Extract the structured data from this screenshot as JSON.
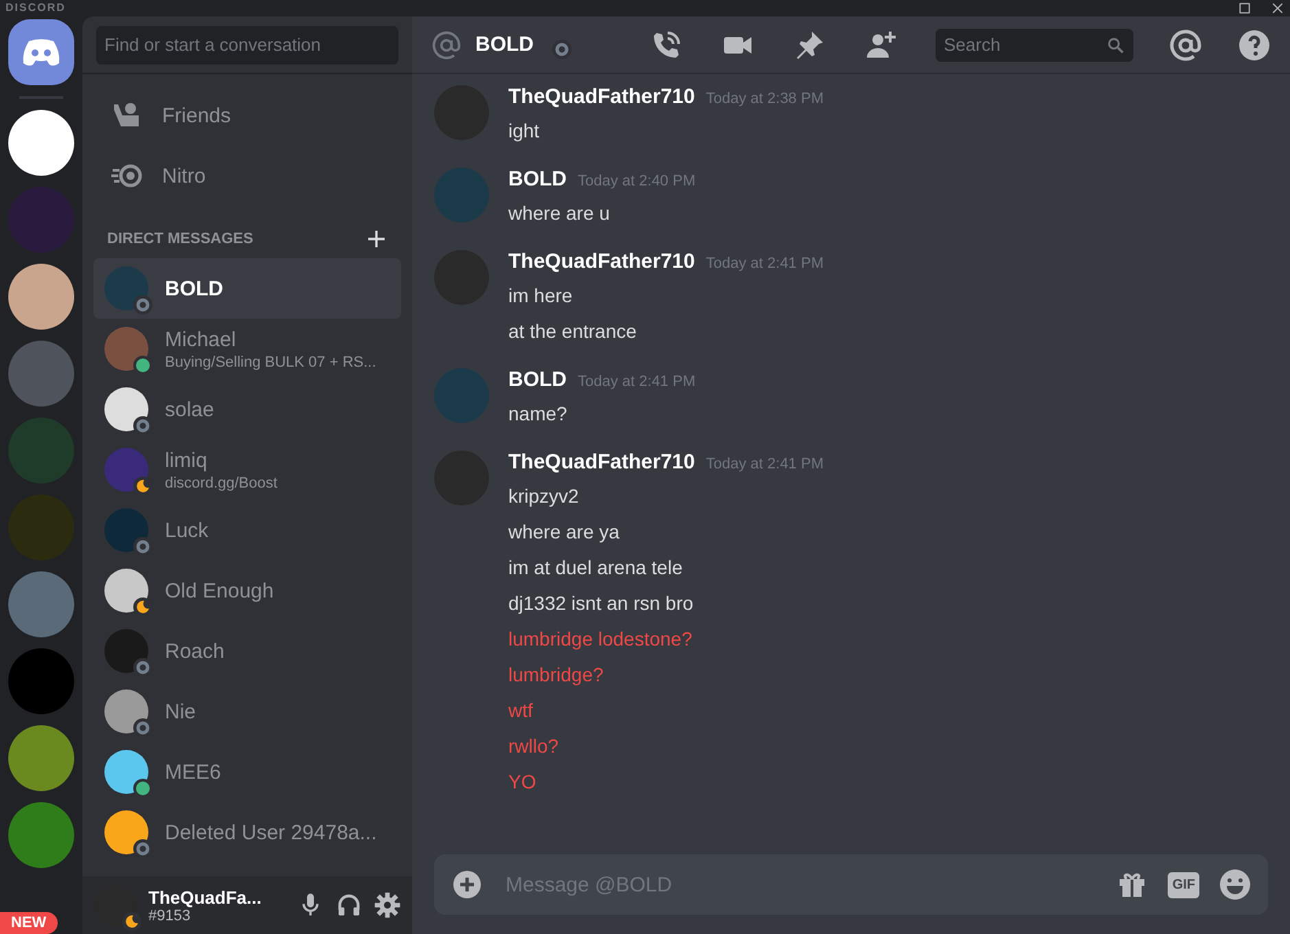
{
  "app": {
    "title": "DISCORD"
  },
  "servers": [
    {
      "kind": "home",
      "color": "#7289da"
    },
    {
      "kind": "server",
      "color": "#ffffff"
    },
    {
      "kind": "server",
      "color": "#2a1a3e"
    },
    {
      "kind": "server",
      "color": "#c9a58e"
    },
    {
      "kind": "server",
      "color": "#4f545c"
    },
    {
      "kind": "server",
      "color": "#1f3b2a"
    },
    {
      "kind": "server",
      "color": "#2b2b10"
    },
    {
      "kind": "server",
      "color": "#5a6a78"
    },
    {
      "kind": "server",
      "color": "#000000"
    },
    {
      "kind": "server",
      "color": "#6a8a20"
    },
    {
      "kind": "server",
      "color": "#2e7d1a"
    }
  ],
  "new_badge": "NEW",
  "search": {
    "placeholder": "Find or start a conversation"
  },
  "nav": [
    {
      "kind": "friends",
      "label": "Friends"
    },
    {
      "kind": "nitro",
      "label": "Nitro"
    }
  ],
  "dm_heading": "DIRECT MESSAGES",
  "dms": [
    {
      "name": "BOLD",
      "kind": "offline",
      "selected": true,
      "color": "#1b3a4a"
    },
    {
      "name": "Michael",
      "subtitle": "Buying/Selling BULK 07 + RS...",
      "kind": "online",
      "selected": false,
      "color": "#7a5040"
    },
    {
      "name": "solae",
      "kind": "offline",
      "selected": false,
      "color": "#dddddd"
    },
    {
      "name": "limiq",
      "subtitle": "discord.gg/Boost",
      "kind": "idle",
      "selected": false,
      "color": "#3a2a7a"
    },
    {
      "name": "Luck",
      "kind": "offline",
      "selected": false,
      "color": "#0e2a3a"
    },
    {
      "name": "Old Enough",
      "kind": "idle",
      "selected": false,
      "color": "#c8c8c8"
    },
    {
      "name": "Roach",
      "kind": "offline",
      "selected": false,
      "color": "#1a1a1a"
    },
    {
      "name": "Nie",
      "kind": "offline",
      "selected": false,
      "color": "#9a9a9a"
    },
    {
      "name": "MEE6",
      "kind": "online",
      "selected": false,
      "color": "#5bc7ef"
    },
    {
      "name": "Deleted User 29478a...",
      "kind": "offline",
      "selected": false,
      "color": "#faa61a"
    }
  ],
  "user": {
    "name": "TheQuadFa...",
    "tag": "#9153",
    "kind": "idle"
  },
  "channel": {
    "name": "BOLD",
    "kind": "offline"
  },
  "header_search": {
    "placeholder": "Search"
  },
  "messages": [
    {
      "author": "TheQuadFather710",
      "time": "Today at 2:38 PM",
      "color": "#2a2a2a",
      "lines": [
        {
          "text": "ight",
          "color": "#dcddde"
        }
      ]
    },
    {
      "author": "BOLD",
      "time": "Today at 2:40 PM",
      "color": "#1b3a4a",
      "lines": [
        {
          "text": "where are u",
          "color": "#dcddde"
        }
      ]
    },
    {
      "author": "TheQuadFather710",
      "time": "Today at 2:41 PM",
      "color": "#2a2a2a",
      "lines": [
        {
          "text": "im here",
          "color": "#dcddde"
        },
        {
          "text": "at the entrance",
          "color": "#dcddde"
        }
      ]
    },
    {
      "author": "BOLD",
      "time": "Today at 2:41 PM",
      "color": "#1b3a4a",
      "lines": [
        {
          "text": "name?",
          "color": "#dcddde"
        }
      ]
    },
    {
      "author": "TheQuadFather710",
      "time": "Today at 2:41 PM",
      "color": "#2a2a2a",
      "lines": [
        {
          "text": "kripzyv2",
          "color": "#dcddde"
        },
        {
          "text": "where are ya",
          "color": "#dcddde"
        },
        {
          "text": "im at duel arena tele",
          "color": "#dcddde"
        },
        {
          "text": "dj1332 isnt an rsn bro",
          "color": "#dcddde"
        },
        {
          "text": "lumbridge lodestone?",
          "color": "#f04747"
        },
        {
          "text": "lumbridge?",
          "color": "#f04747"
        },
        {
          "text": "wtf",
          "color": "#f04747"
        },
        {
          "text": "rwllo?",
          "color": "#f04747"
        },
        {
          "text": "YO",
          "color": "#f04747"
        }
      ]
    }
  ],
  "composer": {
    "placeholder": "Message @BOLD",
    "gif": "GIF"
  }
}
